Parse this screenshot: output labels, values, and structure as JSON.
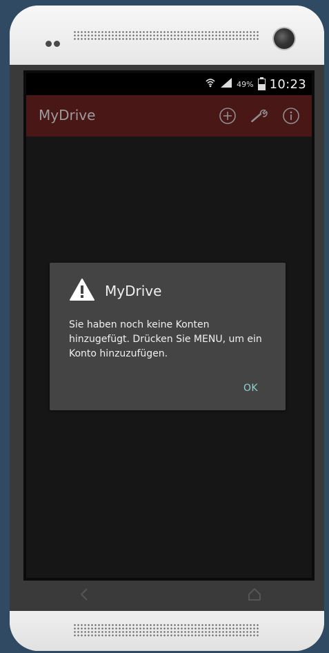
{
  "statusbar": {
    "battery_percent": "49%",
    "time": "10:23",
    "icons": [
      "wifi-icon",
      "signal-icon",
      "battery-icon"
    ]
  },
  "appbar": {
    "title": "MyDrive",
    "actions": [
      {
        "name": "add-icon"
      },
      {
        "name": "settings-wrench-icon"
      },
      {
        "name": "info-icon"
      }
    ]
  },
  "dialog": {
    "icon": "warning-icon",
    "title": "MyDrive",
    "message": "Sie haben noch keine Konten hinzugefügt. Drücken Sie MENU, um ein Konto hinzuzufügen.",
    "ok_label": "OK"
  },
  "navbar": {
    "back_icon": "back-icon",
    "home_icon": "home-icon"
  },
  "colors": {
    "action_bar": "#4a1717",
    "dialog_bg": "#444444",
    "ok_text": "#8fd2d0",
    "screen_bg": "#161616"
  }
}
